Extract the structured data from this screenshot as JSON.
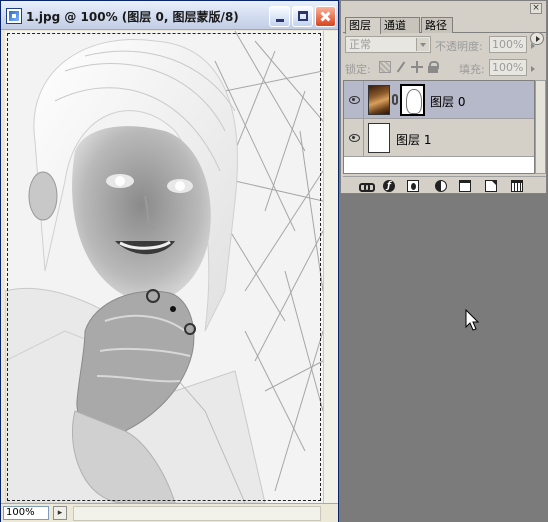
{
  "document": {
    "title": "1.jpg @ 100% (图层 0, 图层蒙版/8)",
    "zoom": "100%",
    "icon": "photoshop-doc-icon"
  },
  "window_controls": [
    "minimize-icon",
    "maximize-icon",
    "close-icon"
  ],
  "layers_panel": {
    "tabs": [
      {
        "label": "图层",
        "active": true
      },
      {
        "label": "通道",
        "active": false
      },
      {
        "label": "路径",
        "active": false
      }
    ],
    "blend_mode": "正常",
    "opacity_label": "不透明度:",
    "opacity_value": "100%",
    "lock_label": "锁定:",
    "lock_icons": [
      "lock-transparency-icon",
      "lock-paint-icon",
      "lock-position-icon",
      "lock-all-icon"
    ],
    "fill_label": "填充:",
    "fill_value": "100%",
    "layers": [
      {
        "name": "图层 0",
        "visible": true,
        "selected": true,
        "has_mask": true
      },
      {
        "name": "图层 1",
        "visible": true,
        "selected": false,
        "has_mask": false
      }
    ],
    "bottom_icons": [
      "link-layers-icon",
      "layer-style-icon",
      "add-mask-icon",
      "adjustment-layer-icon",
      "new-group-icon",
      "new-layer-icon",
      "delete-layer-icon"
    ]
  },
  "colors": {
    "workspace_bg": "#7b7b7b",
    "selected_layer": "#b5b9c9",
    "close_button": "#d9441d"
  }
}
